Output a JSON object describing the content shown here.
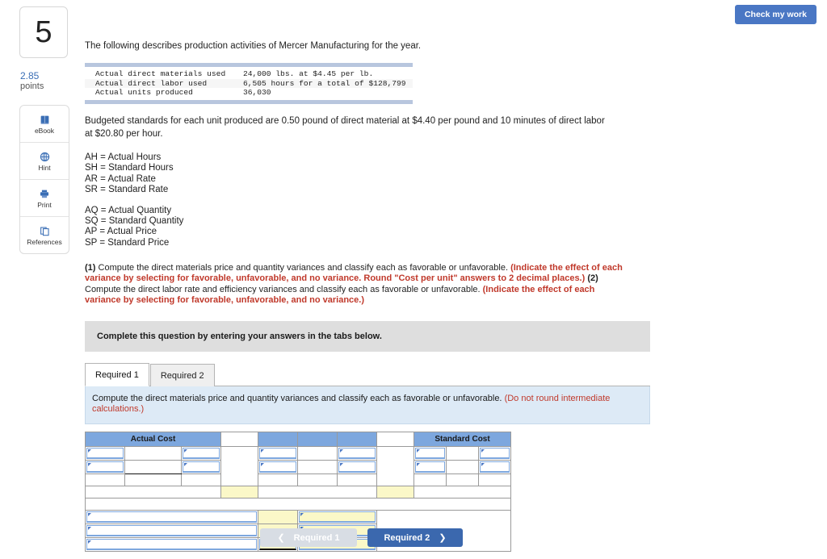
{
  "question": {
    "number": "5",
    "points_value": "2.85",
    "points_label": "points"
  },
  "tools": [
    {
      "label": "eBook",
      "icon": "book-icon"
    },
    {
      "label": "Hint",
      "icon": "globe-icon"
    },
    {
      "label": "Print",
      "icon": "printer-icon"
    },
    {
      "label": "References",
      "icon": "copy-icon"
    }
  ],
  "header": {
    "check_work_label": "Check my work"
  },
  "body": {
    "intro": "The following describes production activities of Mercer Manufacturing for the year.",
    "data_rows": [
      {
        "label": "Actual direct materials used",
        "value": "24,000 lbs. at $4.45 per lb."
      },
      {
        "label": "Actual direct labor used",
        "value": "6,505 hours for a total of $128,799"
      },
      {
        "label": "Actual units produced",
        "value": "36,030"
      }
    ],
    "standards_paragraph": "Budgeted standards for each unit produced are 0.50 pound of direct material at $4.40 per pound and 10 minutes of direct labor at $20.80 per hour.",
    "legend_group_1": [
      "AH = Actual Hours",
      "SH = Standard Hours",
      "AR = Actual Rate",
      "SR = Standard Rate"
    ],
    "legend_group_2": [
      "AQ = Actual Quantity",
      "SQ = Standard Quantity",
      "AP = Actual Price",
      "SP = Standard Price"
    ],
    "requirement_1_num": "(1)",
    "requirement_1_text": " Compute the direct materials price and quantity variances and classify each as favorable or unfavorable. ",
    "requirement_1_red": "(Indicate the effect of each variance by selecting for favorable, unfavorable, and no variance. Round \"Cost per unit\" answers to 2 decimal places.)",
    "requirement_2_num": "(2)",
    "requirement_2_text": " Compute the direct labor rate and efficiency variances and classify each as favorable or unfavorable. ",
    "requirement_2_red": "(Indicate the effect of each variance by selecting for favorable, unfavorable, and no variance.)"
  },
  "complete_bar": {
    "text": "Complete this question by entering your answers in the tabs below."
  },
  "tabs": [
    {
      "label": "Required 1",
      "active": true
    },
    {
      "label": "Required 2",
      "active": false
    }
  ],
  "tab_body": {
    "text": "Compute the direct materials price and quantity variances and classify each as favorable or unfavorable. ",
    "red_note": "(Do not round intermediate calculations.)"
  },
  "answer_grid": {
    "header": {
      "actual_cost": "Actual Cost",
      "standard_cost": "Standard Cost",
      "blank_1": "",
      "mid_1": "",
      "mid_2": "",
      "mid_3": "",
      "blank_2": ""
    },
    "cells": {
      "empty": ""
    }
  },
  "footer": {
    "prev_label": "Required 1",
    "next_label": "Required 2",
    "prev_icon": "chevron-left-icon",
    "next_icon": "chevron-right-icon"
  },
  "colors": {
    "accent_blue": "#4a77c4",
    "header_blue": "#7da7de",
    "red_note": "#c0392b",
    "yellow_cell": "#fbf8c8",
    "banner_gray": "#dedede",
    "tab_body_blue": "#ddeaf6"
  }
}
